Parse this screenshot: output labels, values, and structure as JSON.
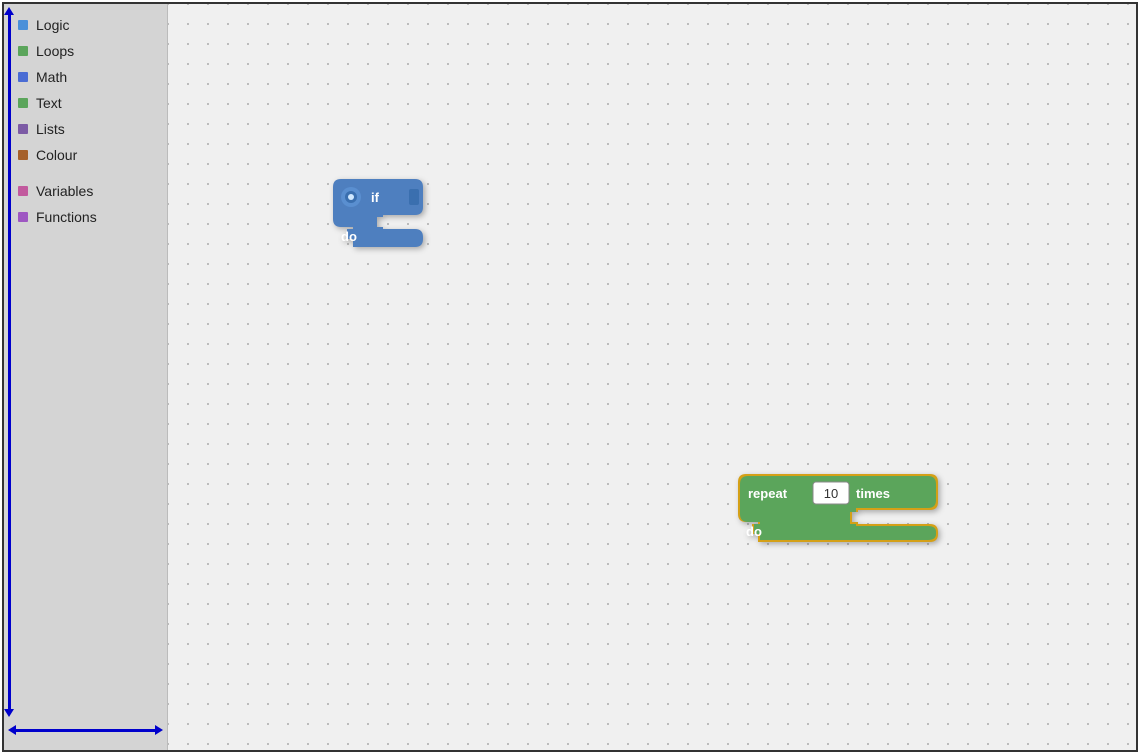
{
  "sidebar": {
    "items": [
      {
        "label": "Logic",
        "color": "#4a90d9",
        "id": "logic"
      },
      {
        "label": "Loops",
        "color": "#5ba55b",
        "id": "loops"
      },
      {
        "label": "Math",
        "color": "#4a6cd4",
        "id": "math"
      },
      {
        "label": "Text",
        "color": "#5ba55b",
        "id": "text"
      },
      {
        "label": "Lists",
        "color": "#7c5ba5",
        "id": "lists"
      },
      {
        "label": "Colour",
        "color": "#a5602a",
        "id": "colour"
      },
      {
        "label": "Variables",
        "color": "#c25a9e",
        "id": "variables"
      },
      {
        "label": "Functions",
        "color": "#9e57c2",
        "id": "functions"
      }
    ],
    "spacer_after": 5
  },
  "blocks": {
    "if_block": {
      "top_label": "if",
      "bottom_label": "do"
    },
    "repeat_block": {
      "repeat_label": "repeat",
      "times_label": "times",
      "do_label": "do",
      "value": "10"
    }
  },
  "colors": {
    "logic_blue": "#4e7fbf",
    "loop_green": "#5ba55b",
    "sidebar_bg": "#d4d4d4",
    "canvas_bg": "#f0f0f0",
    "arrow_blue": "#0000cc",
    "repeat_border": "#d4a017",
    "if_block_bg": "#4e7fbf",
    "repeat_block_bg": "#5ba55b"
  }
}
